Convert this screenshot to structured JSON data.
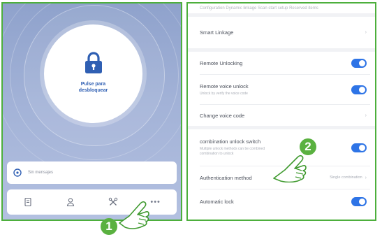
{
  "lock_screen": {
    "unlock_label": "Pulse para\ndesbloquear",
    "messages_text": "Sin mensajes",
    "nav_items": [
      {
        "name": "records",
        "icon": "document-icon"
      },
      {
        "name": "users",
        "icon": "user-icon"
      },
      {
        "name": "settings",
        "icon": "tools-icon"
      },
      {
        "name": "more",
        "icon": "more-dots-icon",
        "label": "•••"
      }
    ]
  },
  "settings": {
    "top_cut_text": "Configuration   Dynamic linkage   Scan start setup   Reserved items",
    "rows": [
      {
        "label": "Smart Linkage",
        "control": "chevron",
        "chevron": "›"
      },
      {
        "label": "Remote Unlocking",
        "control": "toggle",
        "on": true
      },
      {
        "label": "Remote voice unlock",
        "sub": "Unlock by verify the voice code",
        "control": "toggle",
        "on": true
      },
      {
        "label": "Change voice code",
        "control": "chevron",
        "chevron": "›"
      },
      {
        "label": "combination unlock switch",
        "sub": "Multiple unlock methods can be combined\ncombination to unlock",
        "control": "toggle",
        "on": true
      },
      {
        "label": "Authentication method",
        "value": "Single combination",
        "control": "chevron",
        "chevron": "›"
      },
      {
        "label": "Automatic lock",
        "control": "toggle",
        "on": true
      }
    ]
  },
  "callouts": [
    {
      "number": "1"
    },
    {
      "number": "2"
    }
  ],
  "colors": {
    "accent_green": "#5ab140",
    "toggle_blue": "#2e74e6",
    "lock_blue": "#2f5fb3"
  }
}
